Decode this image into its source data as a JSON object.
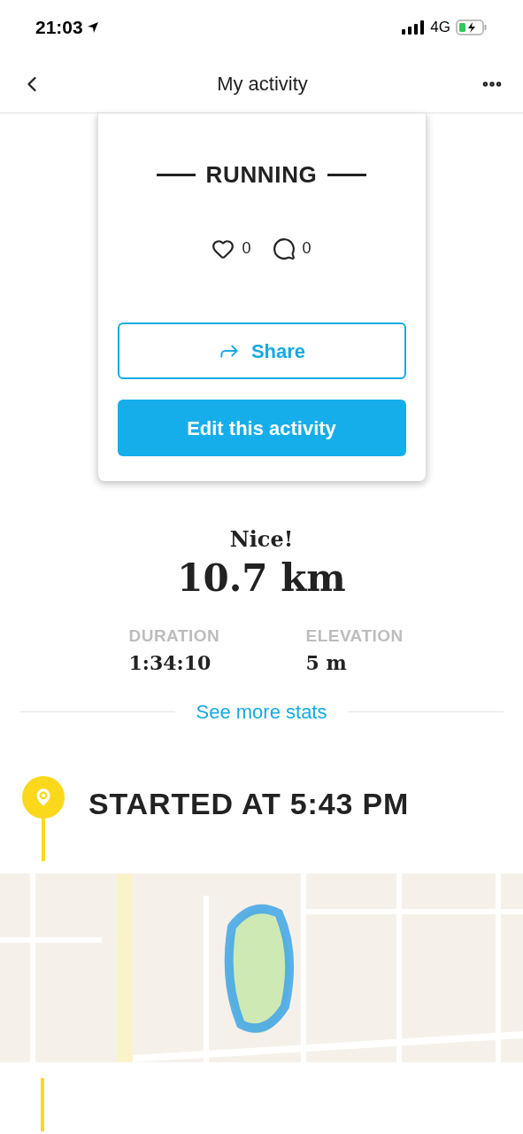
{
  "status_bar": {
    "time": "21:03",
    "network": "4G"
  },
  "nav": {
    "title": "My activity"
  },
  "activity": {
    "sport": "RUNNING",
    "likes": "0",
    "comments": "0",
    "share_label": "Share",
    "edit_label": "Edit this activity"
  },
  "summary": {
    "headline": "Nice!",
    "distance": "10.7 km",
    "stats": [
      {
        "label": "DURATION",
        "value": "1:34:10"
      },
      {
        "label": "ELEVATION",
        "value": "5 m"
      }
    ],
    "more_link": "See more stats"
  },
  "timeline": {
    "started": "STARTED AT 5:43 PM"
  }
}
